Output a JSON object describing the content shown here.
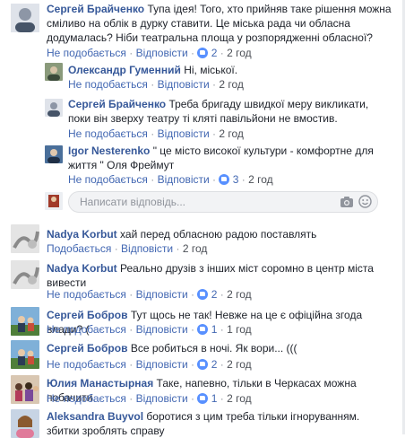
{
  "actions": {
    "dislike": "Не подобається",
    "likes": "Подобається",
    "reply": "Відповісти",
    "sep": "·"
  },
  "reply_placeholder": "Написати відповідь...",
  "comments": [
    {
      "author": "Сергей Брайченко",
      "text": "Тупа ідея! Того, хто прийняв таке рішення можна сміливо на облік в дурку ставити. Це міська рада чи обласна додумалась? Ніби театральна площа у розпорядженні обласної?",
      "reactions": "2",
      "time": "2 год",
      "like_label": "dislike"
    },
    {
      "author": "Олександр Гуменний",
      "text": "Ні, міської.",
      "time": "2 год"
    },
    {
      "author": "Сергей Брайченко",
      "text": "Треба бригаду швидкої меру викликати, поки він зверху театру ті кляті павільйони не вмостив.",
      "time": "2 год"
    },
    {
      "author": "Igor Nesterenko",
      "text": "\" це місто високої культури - комфортне для життя \" Оля Фреймут",
      "reactions": "3",
      "time": "2 год"
    },
    {
      "author": "Nadya Korbut",
      "text": "хай перед обласною радою поставлять",
      "time": "2 год"
    },
    {
      "author": "Nadya Korbut",
      "text": "Реально друзів з інших міст соромно в центр міста вивести",
      "reactions": "2",
      "time": "2 год"
    },
    {
      "author": "Сергей Бобров",
      "text": "Тут щось не так! Невже на це є офіційна згода влади? (",
      "reactions": "1",
      "time": "1 год"
    },
    {
      "author": "Сергей Бобров",
      "text": "Все робиться в ночі. Як вори... (((",
      "reactions": "2",
      "time": "2 год"
    },
    {
      "author": "Юлия Манастырная",
      "text": "Таке, напевно, тільки в Черкасах можна побачити.",
      "reactions": "1",
      "time": "2 год"
    },
    {
      "author": "Aleksandra Buyvol",
      "text": "боротися з цим треба тільки ігноруванням. збитки зроблять справу"
    }
  ],
  "colors": {
    "link": "#365899",
    "meta": "#90949c",
    "reaction": "#5890ff",
    "input_bg": "#f2f3f5"
  }
}
